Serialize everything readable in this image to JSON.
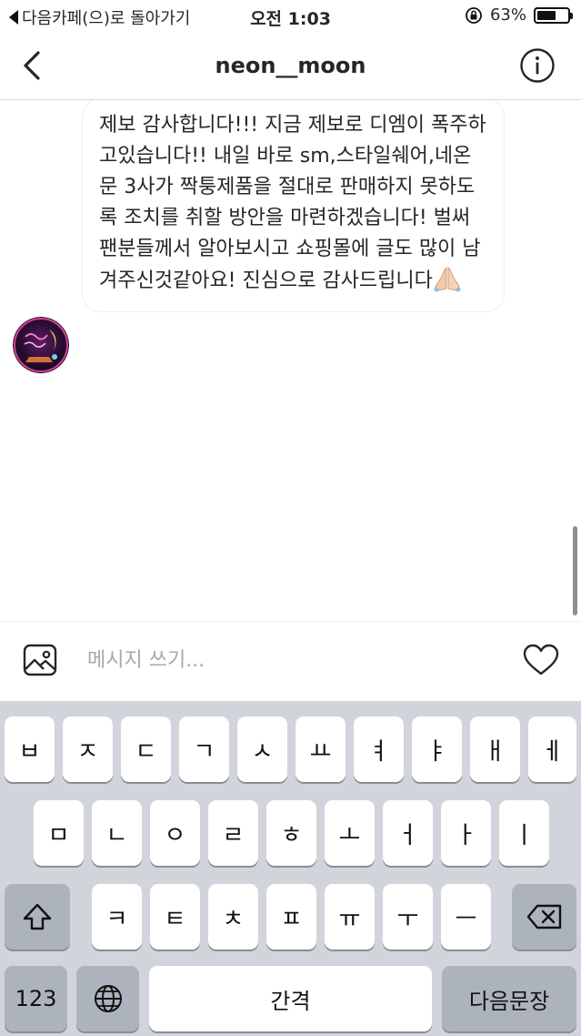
{
  "status_bar": {
    "back_label": "다음카페(으)로 돌아가기",
    "time": "오전 1:03",
    "battery": "63%",
    "battery_level": 0.63
  },
  "header": {
    "title": "neon__moon",
    "back_icon": "chevron-left-icon",
    "info_icon": "info-icon"
  },
  "message": {
    "text": "제보 감사합니다!!! 지금 제보로 디엠이 폭주하고있습니다!! 내일 바로 sm,스타일쉐어,네온문 3사가 짝퉁제품을 절대로 판매하지 못하도록 조치를 취할 방안을 마련하겠습니다! 벌써 팬분들께서 알아보시고 쇼핑몰에 글도 많이 남겨주신것같아요! 진심으로 감사드립니다",
    "emoji": "folded-hands",
    "avatar_icon": "neon-moon-avatar"
  },
  "composer": {
    "placeholder": "메시지 쓰기...",
    "gallery_icon": "image-icon",
    "like_icon": "heart-icon"
  },
  "keyboard": {
    "row1": [
      "ㅂ",
      "ㅈ",
      "ㄷ",
      "ㄱ",
      "ㅅ",
      "ㅛ",
      "ㅕ",
      "ㅑ",
      "ㅐ",
      "ㅔ"
    ],
    "row2": [
      "ㅁ",
      "ㄴ",
      "ㅇ",
      "ㄹ",
      "ㅎ",
      "ㅗ",
      "ㅓ",
      "ㅏ",
      "ㅣ"
    ],
    "row3": [
      "ㅋ",
      "ㅌ",
      "ㅊ",
      "ㅍ",
      "ㅠ",
      "ㅜ",
      "ㅡ"
    ],
    "numbers_label": "123",
    "space_label": "간격",
    "return_label": "다음문장",
    "shift_icon": "shift-icon",
    "delete_icon": "backspace-icon",
    "globe_icon": "globe-icon"
  }
}
